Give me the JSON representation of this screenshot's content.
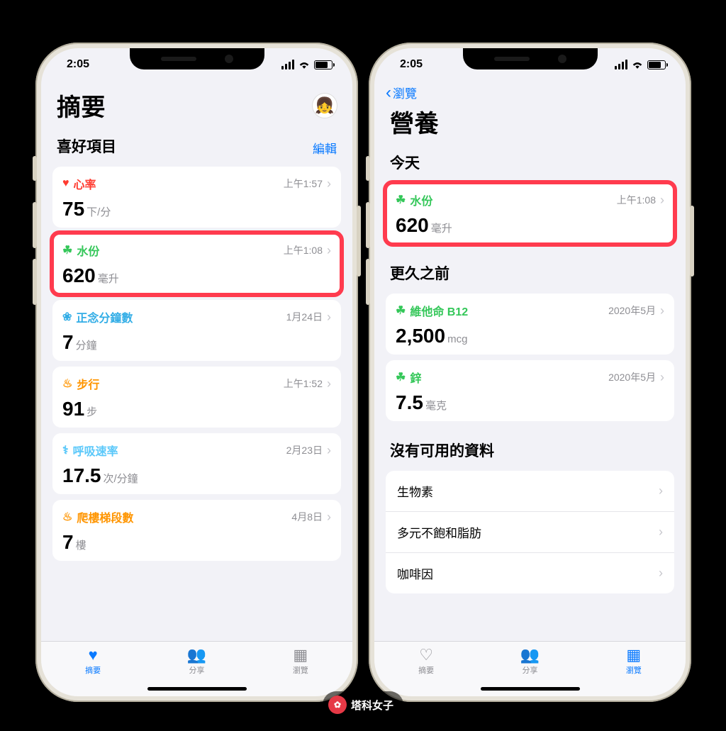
{
  "status": {
    "time": "2:05"
  },
  "left": {
    "title": "摘要",
    "section": {
      "label": "喜好項目",
      "edit": "編輯"
    },
    "cards": [
      {
        "icon": "♥",
        "color": "col-red",
        "name": "心率",
        "time": "上午1:57",
        "value": "75",
        "unit": "下/分"
      },
      {
        "icon": "☘",
        "color": "col-green",
        "name": "水份",
        "time": "上午1:08",
        "value": "620",
        "unit": "毫升",
        "highlight": true
      },
      {
        "icon": "❀",
        "color": "col-teal",
        "name": "正念分鐘數",
        "time": "1月24日",
        "value": "7",
        "unit": "分鐘"
      },
      {
        "icon": "♨",
        "color": "col-orange",
        "name": "步行",
        "time": "上午1:52",
        "value": "91",
        "unit": "步"
      },
      {
        "icon": "⚕",
        "color": "col-blueish",
        "name": "呼吸速率",
        "time": "2月23日",
        "value": "17.5",
        "unit": "次/分鐘"
      },
      {
        "icon": "♨",
        "color": "col-orange",
        "name": "爬樓梯段數",
        "time": "4月8日",
        "value": "7",
        "unit": "樓"
      }
    ],
    "tabs": {
      "summary": "摘要",
      "share": "分享",
      "browse": "瀏覽"
    },
    "activeTab": "summary"
  },
  "right": {
    "back": "瀏覽",
    "title": "營養",
    "sectionToday": "今天",
    "today": [
      {
        "icon": "☘",
        "color": "col-green",
        "name": "水份",
        "time": "上午1:08",
        "value": "620",
        "unit": "毫升",
        "highlight": true
      }
    ],
    "sectionEarlier": "更久之前",
    "earlier": [
      {
        "icon": "☘",
        "color": "col-green",
        "name": "維他命 B12",
        "time": "2020年5月",
        "value": "2,500",
        "unit": "mcg"
      },
      {
        "icon": "☘",
        "color": "col-green",
        "name": "鋅",
        "time": "2020年5月",
        "value": "7.5",
        "unit": "毫克"
      }
    ],
    "sectionNoData": "沒有可用的資料",
    "noData": [
      "生物素",
      "多元不飽和脂肪",
      "咖啡因"
    ],
    "tabs": {
      "summary": "摘要",
      "share": "分享",
      "browse": "瀏覽"
    },
    "activeTab": "browse"
  },
  "watermark": "塔科女子"
}
